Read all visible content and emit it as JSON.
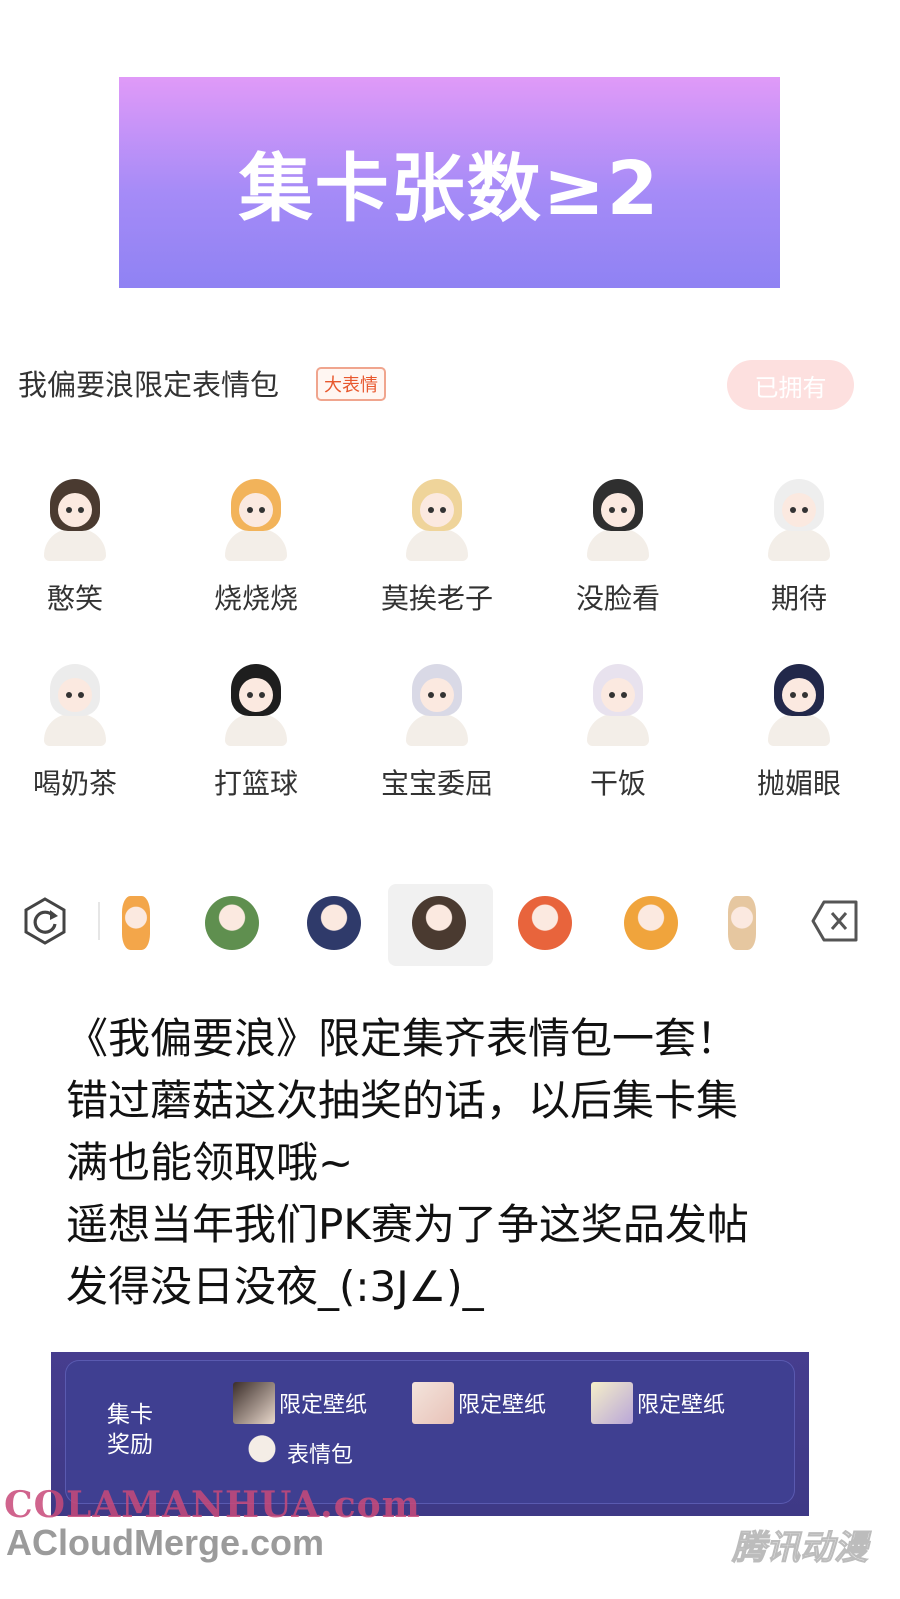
{
  "banner": {
    "text": "集卡张数≥2"
  },
  "pack": {
    "title": "我偏要浪限定表情包",
    "tag": "大表情",
    "owned_label": "已拥有"
  },
  "stickers": [
    {
      "label": "憨笑",
      "hair": "#4a3a30"
    },
    {
      "label": "烧烧烧",
      "hair": "#f2b35a"
    },
    {
      "label": "莫挨老子",
      "hair": "#efd49a"
    },
    {
      "label": "没脸看",
      "hair": "#2f2f2f"
    },
    {
      "label": "期待",
      "hair": "#eeeeee"
    },
    {
      "label": "喝奶茶",
      "hair": "#ececec"
    },
    {
      "label": "打篮球",
      "hair": "#1e1e1e"
    },
    {
      "label": "宝宝委屈",
      "hair": "#d9d9e6"
    },
    {
      "label": "干饭",
      "hair": "#e8e2ee"
    },
    {
      "label": "抛媚眼",
      "hair": "#22284a"
    }
  ],
  "emoji_bar": {
    "refresh_icon": "refresh-icon",
    "delete_icon": "backspace-icon",
    "thumbs": [
      "#f3a64a",
      "#5f8f4f",
      "#2f3a6a",
      "#4a3a30",
      "#e8643c",
      "#f0a43c",
      "#e6c7a0"
    ]
  },
  "caption": {
    "lines": [
      "《我偏要浪》限定集齐表情包一套！",
      "错过蘑菇这次抽奖的话，以后集卡集",
      "满也能领取哦~",
      "遥想当年我们PK赛为了争这奖品发帖",
      "发得没日没夜_(:3J∠)_"
    ]
  },
  "reward": {
    "label_line1": "集卡",
    "label_line2": "奖励",
    "items": [
      {
        "label": "限定壁纸"
      },
      {
        "label": "限定壁纸"
      },
      {
        "label": "限定壁纸"
      },
      {
        "label": "表情包"
      }
    ]
  },
  "watermarks": {
    "colamanhua": "COLAMANHUA.com",
    "acloud": "ACloudMerge.com",
    "tencent": "腾讯动漫"
  }
}
